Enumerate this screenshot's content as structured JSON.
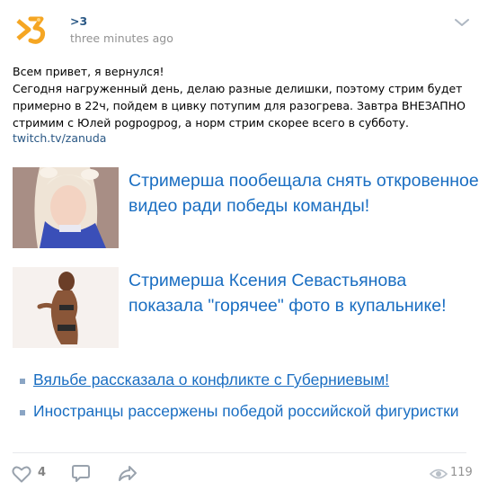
{
  "post": {
    "author": ">3",
    "time": "three minutes ago",
    "text_lines": [
      "Всем привет, я вернулся!",
      "Сегодня нагруженный день, делаю разные делишки, поэтому стрим будет",
      "примерно в 22ч, пойдем в цивку потупим для разогрева. Завтра ВНЕЗАПНО",
      "стримим с Юлей pogpogpog, а норм стрим скорее всего в субботу."
    ],
    "link": "twitch.tv/zanuda"
  },
  "teasers": [
    {
      "line1": "Стримерша пообещала снять откровенное",
      "line2": "видео ради победы команды!"
    },
    {
      "line1": "Стримерша Ксения  Севастьянова",
      "line2": "показала \"горячее\" фото в купальнике!"
    }
  ],
  "news": [
    "Вяльбе рассказала о конфликте с Губерниевым!",
    "Иностранцы рассержены победой российской фигуристки"
  ],
  "footer": {
    "likes": "4",
    "views": "119"
  },
  "colors": {
    "link": "#2a5885",
    "teaser": "#1a6ec2",
    "muted": "#939393",
    "avatar": "#f5a623"
  },
  "icons": [
    "avatar-logo",
    "chevron-down-icon",
    "heart-icon",
    "comment-icon",
    "share-icon",
    "eye-icon"
  ]
}
